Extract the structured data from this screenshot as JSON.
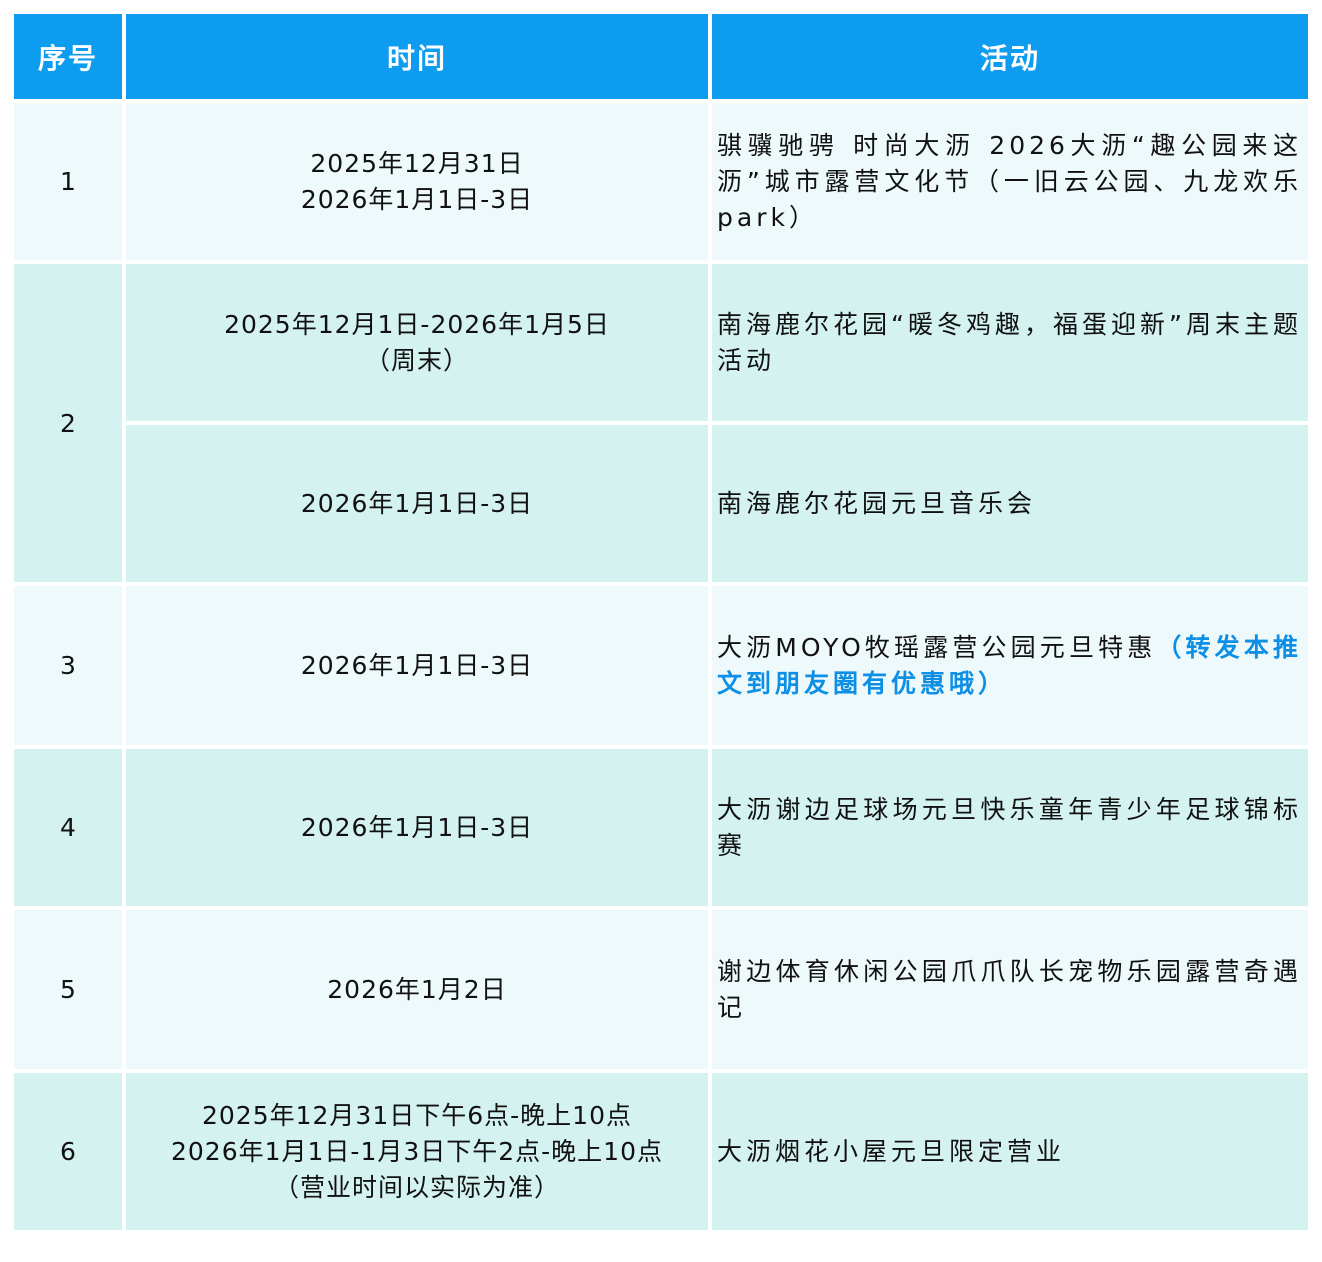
{
  "header": {
    "index": "序号",
    "time": "时间",
    "activity": "活动"
  },
  "rows": [
    {
      "index": "1",
      "time": [
        "2025年12月31日",
        "2026年1月1日-3日"
      ],
      "activity": "骐骥驰骋 时尚大沥 2026大沥“趣公园来这沥”城市露营文化节（一旧云公园、九龙欢乐park）"
    },
    {
      "index": "2",
      "sub": [
        {
          "time": [
            "2025年12月1日-2026年1月5日",
            "（周末）"
          ],
          "activity": "南海鹿尔花园“暖冬鸡趣，福蛋迎新”周末主题活动"
        },
        {
          "time": [
            "2026年1月1日-3日"
          ],
          "activity": "南海鹿尔花园元旦音乐会"
        }
      ]
    },
    {
      "index": "3",
      "time": [
        "2026年1月1日-3日"
      ],
      "activity": "大沥MOYO牧瑶露营公园元旦特惠",
      "activity_highlight": "（转发本推文到朋友圈有优惠哦）"
    },
    {
      "index": "4",
      "time": [
        "2026年1月1日-3日"
      ],
      "activity": "大沥谢边足球场元旦快乐童年青少年足球锦标赛"
    },
    {
      "index": "5",
      "time": [
        "2026年1月2日"
      ],
      "activity": "谢边体育休闲公园爪爪队长宠物乐园露营奇遇记"
    },
    {
      "index": "6",
      "time": [
        "2025年12月31日下午6点-晚上10点",
        "2026年1月1日-1月3日下午2点-晚上10点",
        "（营业时间以实际为准）"
      ],
      "activity": "大沥烟花小屋元旦限定营业"
    }
  ],
  "colors": {
    "header": "#0e9cf0",
    "row_light": "#eef9fc",
    "row_teal": "#d3f2f0",
    "highlight": "#0d8fe6"
  }
}
